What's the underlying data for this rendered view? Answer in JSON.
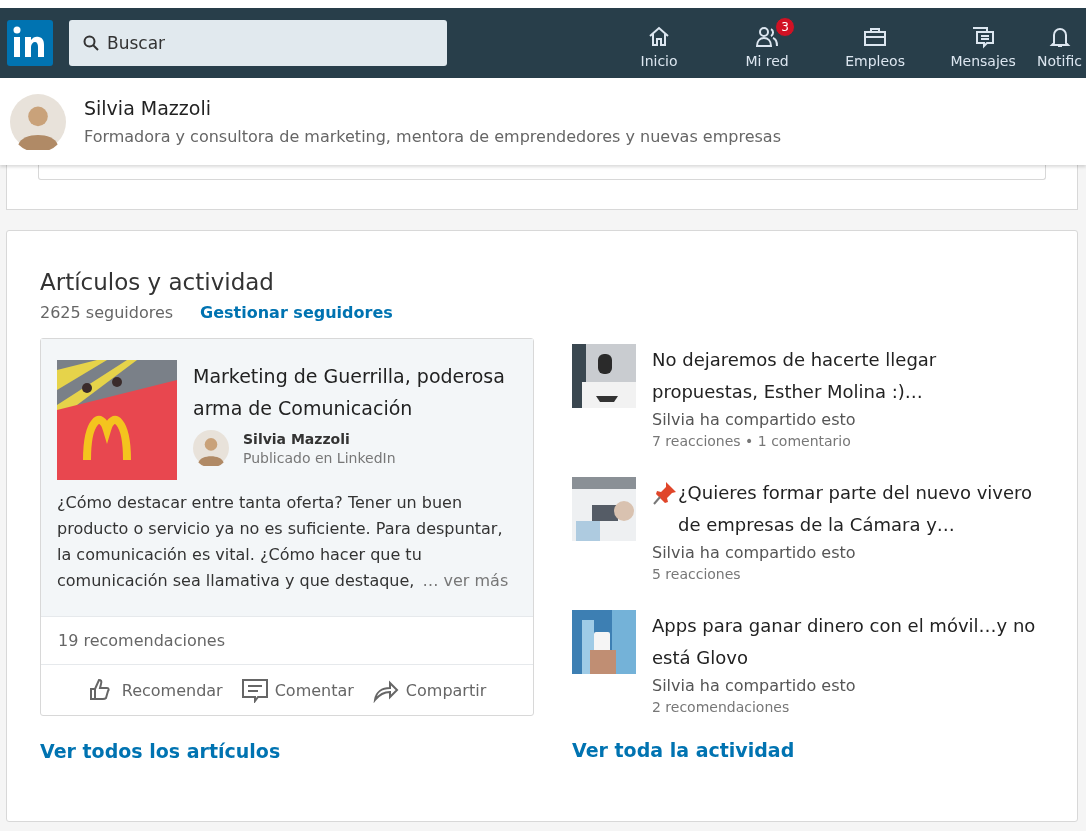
{
  "nav": {
    "search": {
      "placeholder": "Buscar"
    },
    "items": [
      {
        "label": "Inicio"
      },
      {
        "label": "Mi red",
        "badge": "3"
      },
      {
        "label": "Empleos"
      },
      {
        "label": "Mensajes"
      },
      {
        "label": "Notific"
      }
    ]
  },
  "profile": {
    "name": "Silvia Mazzoli",
    "headline": "Formadora y consultora de marketing, mentora de emprendedores y nuevas empresas"
  },
  "activity": {
    "title": "Artículos y actividad",
    "followers": "2625 seguidores",
    "manage_link": "Gestionar seguidores",
    "article": {
      "title": "Marketing de Guerrilla, poderosa arma de Comunicación",
      "author": "Silvia Mazzoli",
      "published": "Publicado en LinkedIn",
      "excerpt": "¿Cómo destacar entre tanta oferta? Tener un buen producto o servicio ya no es suficiente. Para despuntar, la comunicación es vital. ¿Cómo hacer que tu comunicación sea llamativa y que destaque,",
      "more": "… ver más",
      "count": "19 recomendaciones",
      "actions": [
        {
          "label": "Recomendar"
        },
        {
          "label": "Comentar"
        },
        {
          "label": "Compartir"
        }
      ]
    },
    "all_articles": "Ver todos los artículos",
    "posts": [
      {
        "pinned": false,
        "title": "No dejaremos de hacerte llegar propuestas, Esther Molina :)…",
        "shared": "Silvia ha compartido esto",
        "stats": "7 reacciones • 1 comentario"
      },
      {
        "pinned": true,
        "title": "¿Quieres formar parte del nuevo vivero de empresas de la Cámara y…",
        "shared": "Silvia ha compartido esto",
        "stats": "5 reacciones"
      },
      {
        "pinned": false,
        "title": "Apps para ganar dinero con el móvil…y no está Glovo",
        "shared": "Silvia ha compartido esto",
        "stats": "2 recomendaciones"
      }
    ],
    "all_activity": "Ver toda la actividad"
  }
}
